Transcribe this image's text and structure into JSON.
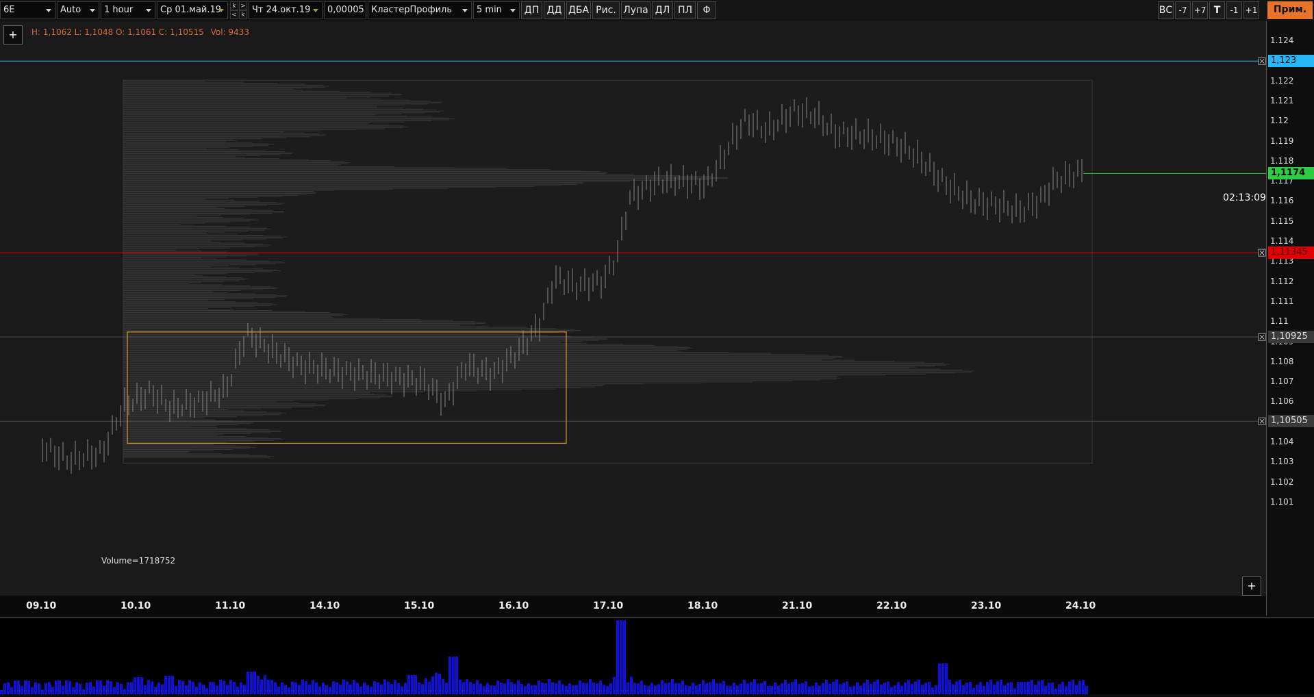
{
  "toolbar": {
    "symbol": "6E",
    "scale_mode": "Auto",
    "timeframe": "1 hour",
    "date_from": "Ср 01.май.19",
    "date_to": "Чт 24.окт.19",
    "tick_size": "0,00005",
    "chart_type": "КластерПрофиль",
    "cluster_period": "5 min",
    "spin_labels": [
      "k",
      ">",
      "<",
      "k"
    ],
    "tool_buttons": [
      "ДП",
      "ДД",
      "ДБА",
      "Рис.",
      "Лупа",
      "ДЛ",
      "ПЛ",
      "Φ"
    ],
    "right_buttons": [
      "ВС",
      "-7",
      "+7",
      "T",
      "-1",
      "+1"
    ],
    "apply_button": "Прим."
  },
  "info": {
    "ohlc": "H: 1,1062 L: 1,1048 O: 1,1061 C: 1,10515",
    "vol": "Vol: 9433"
  },
  "chart": {
    "plus_label": "+",
    "volume_label": "Volume=1718752",
    "timer": "02:13:09",
    "y_ticks": [
      "1.124",
      "1.123",
      "1.122",
      "1.121",
      "1.12",
      "1.119",
      "1.118",
      "1.117",
      "1.116",
      "1.115",
      "1.114",
      "1.113",
      "1.112",
      "1.111",
      "1.11",
      "1.109",
      "1.108",
      "1.107",
      "1.106",
      "1.105",
      "1.104",
      "1.103",
      "1.102",
      "1.101"
    ],
    "x_ticks": [
      "09.10",
      "10.10",
      "11.10",
      "14.10",
      "15.10",
      "16.10",
      "17.10",
      "18.10",
      "21.10",
      "22.10",
      "23.10",
      "24.10"
    ],
    "price_levels": [
      {
        "label": "1,123",
        "price": 1.123,
        "color": "#29b6f6",
        "text_color": "#0a0a0a"
      },
      {
        "label": "1,1174",
        "price": 1.1174,
        "color": "#2ecc40",
        "text_color": "#0a0a0a"
      },
      {
        "label": "1,11345",
        "price": 1.11345,
        "color": "#e00000",
        "text_color": "#400000"
      },
      {
        "label": "1,10925",
        "price": 1.10925,
        "color": "#3a3a3a",
        "text_color": "#e0e0e0"
      },
      {
        "label": "1,10505",
        "price": 1.10505,
        "color": "#3a3a3a",
        "text_color": "#e0e0e0"
      }
    ],
    "colors": {
      "volume_bars": "#1010d8",
      "highlight_box": "#d89a2a",
      "candles": "#8a8a8a"
    }
  }
}
